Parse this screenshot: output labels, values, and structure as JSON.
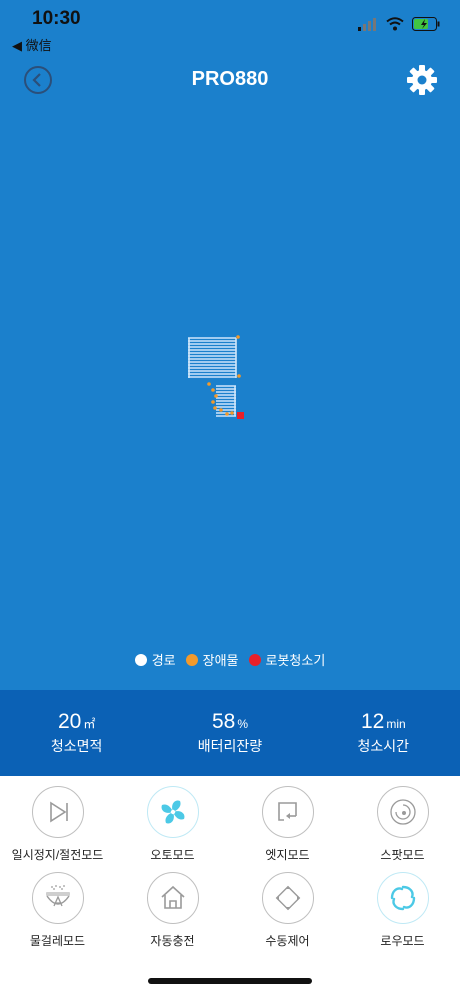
{
  "status": {
    "time": "10:30",
    "back_app": "◀ 微信"
  },
  "nav": {
    "title": "PRO880"
  },
  "legend": [
    {
      "label": "경로",
      "color": "#ffffff"
    },
    {
      "label": "장애물",
      "color": "#f39a2b"
    },
    {
      "label": "로봇청소기",
      "color": "#e8202a"
    }
  ],
  "stats": [
    {
      "value": "20",
      "unit": "㎡",
      "label": "청소면적"
    },
    {
      "value": "58",
      "unit": "%",
      "label": "배터리잔량"
    },
    {
      "value": "12",
      "unit": "min",
      "label": "청소시간"
    }
  ],
  "modes": [
    {
      "label": "일시정지/절전모드",
      "icon": "pause-play-icon"
    },
    {
      "label": "오토모드",
      "icon": "fan-icon"
    },
    {
      "label": "엣지모드",
      "icon": "edge-icon"
    },
    {
      "label": "스팟모드",
      "icon": "spot-icon"
    },
    {
      "label": "물걸레모드",
      "icon": "mop-icon"
    },
    {
      "label": "자동충전",
      "icon": "home-icon"
    },
    {
      "label": "수동제어",
      "icon": "direction-pad-icon"
    },
    {
      "label": "로우모드",
      "icon": "swirl-icon"
    }
  ],
  "colors": {
    "map_bg": "#1b80cc",
    "stats_bg": "#0b61b5",
    "path": "#ffffff",
    "obstacle": "#f39a2b",
    "robot": "#e8202a",
    "accent": "#4cc9e6"
  }
}
